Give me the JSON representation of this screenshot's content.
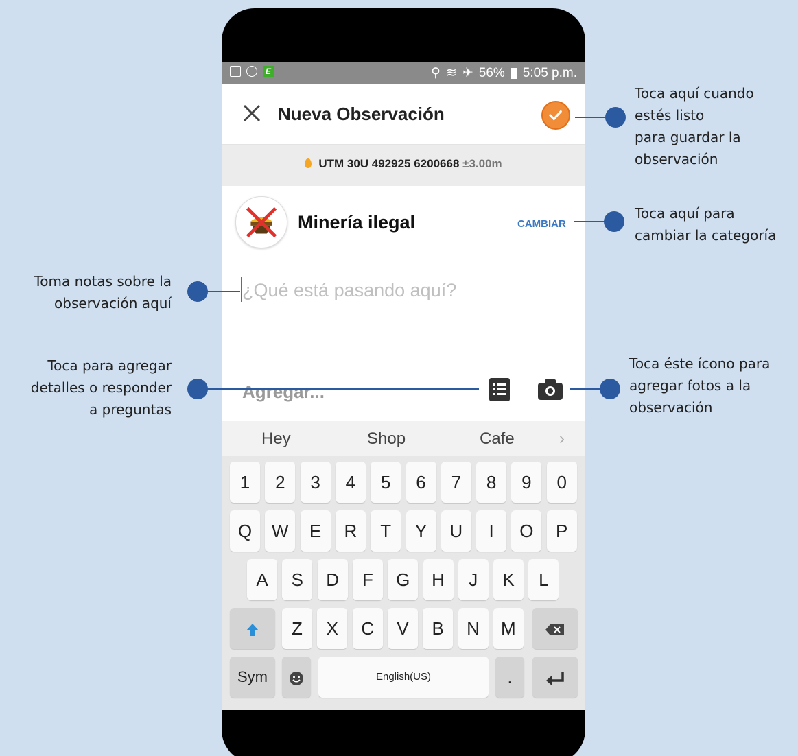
{
  "status_bar": {
    "battery": "56%",
    "time": "5:05 p.m."
  },
  "app_bar": {
    "title": "Nueva Observación"
  },
  "location": {
    "text": "UTM 30U 492925 6200668",
    "accuracy": "±3.00m"
  },
  "category": {
    "name": "Minería ilegal",
    "change_label": "CAMBIAR"
  },
  "notes": {
    "placeholder": "¿Qué está pasando aquí?"
  },
  "add_row": {
    "label": "Agregar..."
  },
  "keyboard": {
    "suggestions": [
      "Hey",
      "Shop",
      "Cafe"
    ],
    "row1": [
      "1",
      "2",
      "3",
      "4",
      "5",
      "6",
      "7",
      "8",
      "9",
      "0"
    ],
    "row2": [
      "Q",
      "W",
      "E",
      "R",
      "T",
      "Y",
      "U",
      "I",
      "O",
      "P"
    ],
    "row3": [
      "A",
      "S",
      "D",
      "F",
      "G",
      "H",
      "J",
      "K",
      "L"
    ],
    "row4": [
      "Z",
      "X",
      "C",
      "V",
      "B",
      "N",
      "M"
    ],
    "sym": "Sym",
    "space": "English(US)",
    "period": "."
  },
  "annotations": {
    "save": [
      "Toca aquí cuando",
      "estés listo",
      "para guardar la",
      "observación"
    ],
    "category": [
      "Toca aquí para",
      "cambiar la categoría"
    ],
    "notes": [
      "Toma notas sobre la",
      "observación aquí"
    ],
    "details": [
      "Toca para agregar",
      "detalles o responder",
      "a preguntas"
    ],
    "photos": [
      "Toca éste ícono para",
      "agregar fotos a la",
      "observación"
    ]
  }
}
